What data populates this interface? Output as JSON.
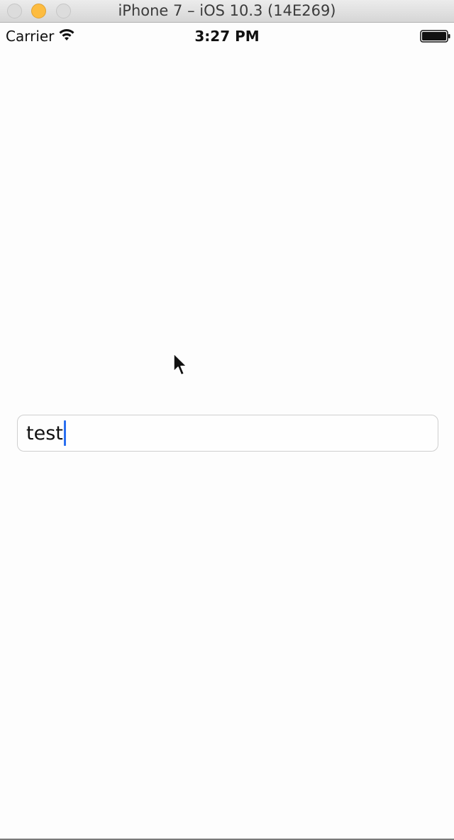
{
  "window": {
    "title": "iPhone 7 – iOS 10.3 (14E269)",
    "traffic_lights": {
      "close": "#dcdcdc",
      "minimize": "#fdbc40",
      "zoom": "#dcdcdc"
    }
  },
  "status_bar": {
    "carrier": "Carrier",
    "time": "3:27 PM",
    "icons": [
      "wifi-icon",
      "battery-icon"
    ]
  },
  "text_field": {
    "value": "test",
    "caret_color": "#2a6ff0"
  },
  "colors": {
    "background": "#fdfdfd",
    "field_border": "#cfcfcf"
  },
  "cursor": {
    "icon": "mouse-pointer-icon"
  }
}
